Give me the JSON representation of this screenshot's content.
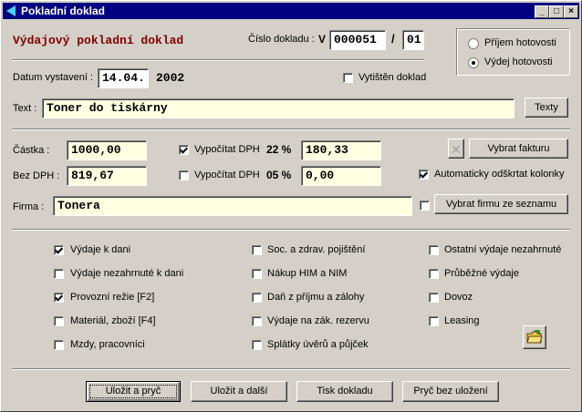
{
  "window": {
    "title": "Pokladní doklad"
  },
  "document": {
    "heading": "Výdajový pokladní doklad",
    "number_label": "Číslo dokladu :",
    "number_prefix": "V",
    "number_value": "000051",
    "slash": "/",
    "number_suffix": "01"
  },
  "type_group": {
    "options": [
      {
        "label": "Příjem hotovosti",
        "selected": false
      },
      {
        "label": "Výdej hotovosti",
        "selected": true
      }
    ]
  },
  "date": {
    "label": "Datum vystavení :",
    "day_month": "14.04.",
    "year": "2002"
  },
  "printed": {
    "label": "Vytištěn doklad",
    "checked": false
  },
  "text": {
    "label": "Text :",
    "value": "Toner do tiskárny",
    "button": "Texty"
  },
  "amount": {
    "label": "Částka :",
    "value": "1000,00"
  },
  "net": {
    "label": "Bez DPH :",
    "value": "819,67"
  },
  "vat1": {
    "label": "Vypočítat DPH",
    "rate": "22 %",
    "value": "180,33",
    "checked": true
  },
  "vat2": {
    "label": "Vypočítat DPH",
    "rate": "05 %",
    "value": "0,00",
    "checked": false
  },
  "invoice": {
    "clear_icon": "x-icon",
    "button": "Vybrat fakturu"
  },
  "auto_strike": {
    "label": "Automaticky odškrtat kolonky",
    "checked": true
  },
  "company": {
    "label": "Firma :",
    "value": "Tonera",
    "button": "Vybrat firmu ze seznamu",
    "checked": false
  },
  "categories": {
    "col1": [
      {
        "label": "Výdaje k dani",
        "checked": true
      },
      {
        "label": "Výdaje nezahrnuté k dani",
        "checked": false
      },
      {
        "label": "Provozní režie  [F2]",
        "checked": true
      },
      {
        "label": "Materiál, zboží  [F4]",
        "checked": false
      },
      {
        "label": "Mzdy, pracovníci",
        "checked": false
      }
    ],
    "col2": [
      {
        "label": "Soc. a zdrav. pojištění",
        "checked": false
      },
      {
        "label": "Nákup HIM a NIM",
        "checked": false
      },
      {
        "label": "Daň z příjmu a zálohy",
        "checked": false
      },
      {
        "label": "Výdaje na zák. rezervu",
        "checked": false
      },
      {
        "label": "Splátky úvěrů a půjček",
        "checked": false
      }
    ],
    "col3": [
      {
        "label": "Ostatní výdaje nezahrnuté",
        "checked": false
      },
      {
        "label": "Průběžné výdaje",
        "checked": false
      },
      {
        "label": "Dovoz",
        "checked": false
      },
      {
        "label": "Leasing",
        "checked": false
      }
    ]
  },
  "folder_icon": "folder-icon",
  "footer": {
    "save_exit": "Uložit a pryč",
    "save_next": "Uložit a další",
    "print": "Tisk dokladu",
    "exit_nosave": "Pryč bez uložení"
  },
  "colors": {
    "title_bar": "#000080",
    "field_bg": "#ffffe1",
    "heading": "#800000"
  }
}
